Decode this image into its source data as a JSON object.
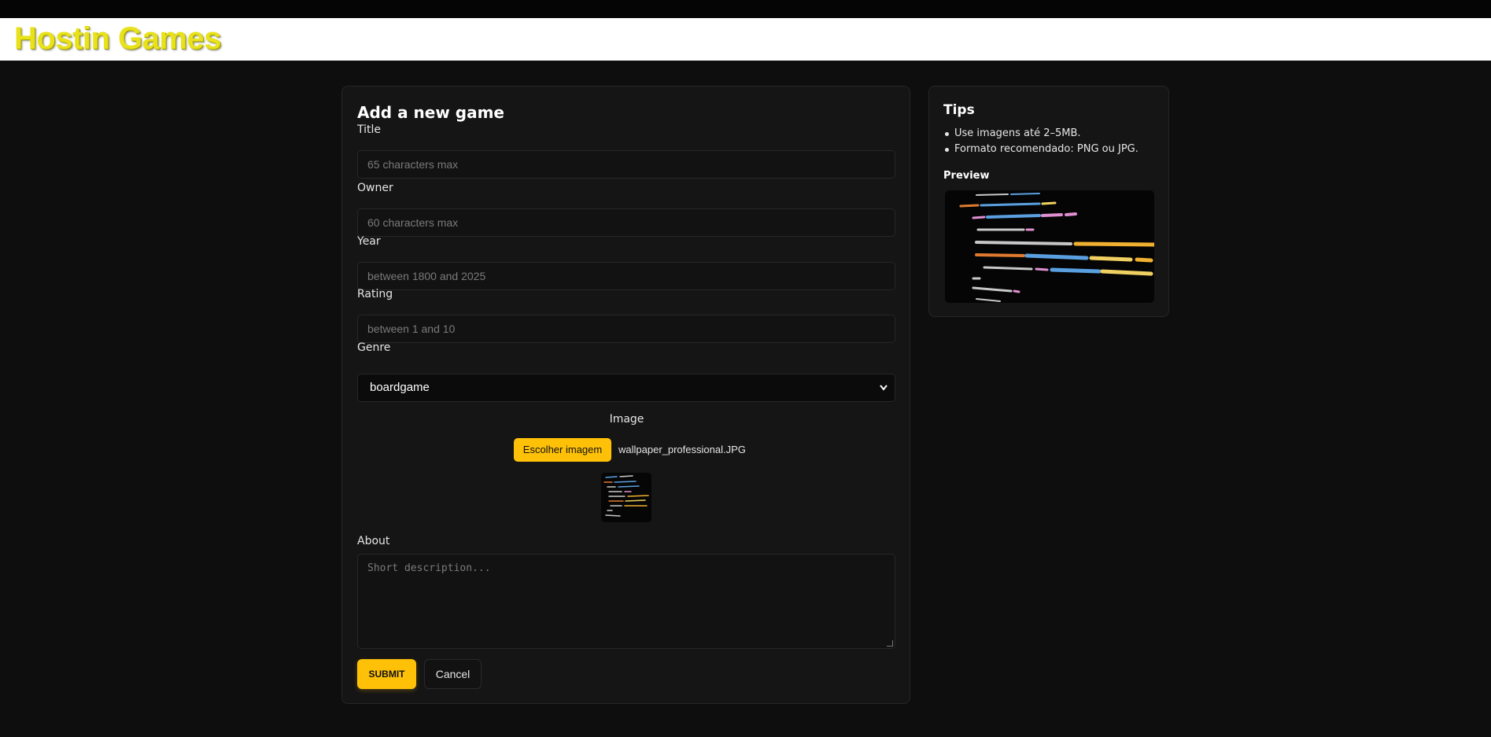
{
  "header": {
    "brand": "Hostin Games",
    "brand_color": "#e8e21b"
  },
  "form": {
    "title": "Add a new game",
    "fields": {
      "title": {
        "label": "Title",
        "placeholder": "65 characters max"
      },
      "owner": {
        "label": "Owner",
        "placeholder": "60 characters max"
      },
      "year": {
        "label": "Year",
        "placeholder": "between 1800 and 2025"
      },
      "rating": {
        "label": "Rating",
        "placeholder": "between 1 and 10"
      },
      "genre": {
        "label": "Genre",
        "selected": "boardgame"
      },
      "image": {
        "label": "Image",
        "button_label": "Escolher imagem",
        "file_name": "wallpaper_professional.JPG"
      },
      "about": {
        "label": "About",
        "placeholder": "Short description..."
      }
    },
    "submit_label": "SUBMIT",
    "cancel_label": "Cancel"
  },
  "tips": {
    "title": "Tips",
    "items": [
      "Use imagens até 2–5MB.",
      "Formato recomendado: PNG ou JPG."
    ],
    "preview_label": "Preview"
  },
  "colors": {
    "accent": "#ffc107",
    "background": "#0e0e0e",
    "card": "#151515"
  }
}
